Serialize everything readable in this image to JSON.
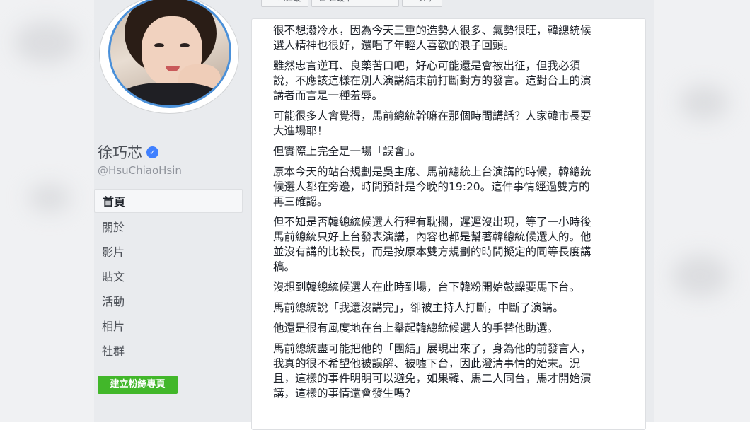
{
  "top_tabs": [
    {
      "label": "已追蹤",
      "icon": "check-icon"
    },
    {
      "label": "追蹤中",
      "icon": "feed-icon"
    },
    {
      "label": "分享",
      "icon": "share-icon"
    }
  ],
  "profile": {
    "name": "徐巧芯",
    "handle": "@HsuChiaoHsin",
    "verified": true
  },
  "nav": {
    "items": [
      {
        "label": "首頁",
        "active": true
      },
      {
        "label": "關於"
      },
      {
        "label": "影片"
      },
      {
        "label": "貼文"
      },
      {
        "label": "活動"
      },
      {
        "label": "相片"
      },
      {
        "label": "社群"
      }
    ],
    "create_button": "建立粉絲專頁"
  },
  "post": {
    "paragraphs": [
      "很不想潑冷水，因為今天三重的造勢人很多、氣勢很旺，韓總統候\n選人精神也很好，還唱了年輕人喜歡的浪子回頭。",
      "雖然忠言逆耳、良藥苦口吧，好心可能還是會被出征，但我必須\n說，不應該這樣在別人演講結束前打斷對方的發言。這對台上的演\n講者而言是一種羞辱。",
      "可能很多人會覺得，馬前總統幹嘛在那個時間講話？人家韓市長要\n大進場耶！",
      "但實際上完全是一場「誤會」。",
      "原本今天的站台規劃是吳主席、馬前總統上台演講的時候，韓總統\n候選人都在旁邊，時間預計是今晚的19:20。這件事情經過雙方的\n再三確認。",
      "但不知是否韓總統候選人行程有耽擱，遲遲沒出現，等了一小時後\n馬前總統只好上台發表演講，內容也都是幫著韓總統候選人的。他\n並沒有講的比較長，而是按原本雙方規劃的時間擬定的同等長度講\n稿。",
      "沒想到韓總統候選人在此時到場，台下韓粉開始鼓譟要馬下台。",
      "馬前總統說「我還沒講完」，卻被主持人打斷，中斷了演講。",
      "他還是很有風度地在台上舉起韓總統候選人的手替他助選。",
      "馬前總統盡可能把他的「團結」展現出來了，身為他的前發言人，\n我真的很不希望他被誤解、被噓下台，因此澄清事情的始末。況\n且，這樣的事件明明可以避免，如果韓、馬二人同台，馬才開始演\n講，這樣的事情還會發生嗎？"
    ]
  },
  "colors": {
    "accent_blue": "#4080ff",
    "create_green": "#42b72a",
    "page_bg": "#e9ebee"
  }
}
